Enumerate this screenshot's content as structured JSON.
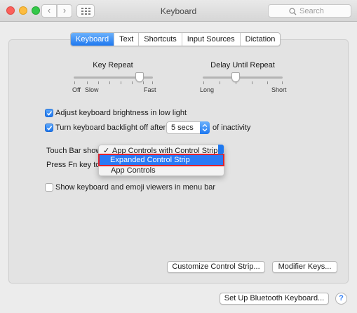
{
  "window": {
    "title": "Keyboard"
  },
  "toolbar": {
    "back": "‹",
    "forward": "›",
    "search_placeholder": "Search"
  },
  "tabs": [
    {
      "label": "Keyboard",
      "active": true
    },
    {
      "label": "Text",
      "active": false
    },
    {
      "label": "Shortcuts",
      "active": false
    },
    {
      "label": "Input Sources",
      "active": false
    },
    {
      "label": "Dictation",
      "active": false
    }
  ],
  "key_repeat": {
    "title": "Key Repeat",
    "min_label_1": "Off",
    "min_label_2": "Slow",
    "max_label": "Fast",
    "level": 0.88
  },
  "delay_until_repeat": {
    "title": "Delay Until Repeat",
    "min_label": "Long",
    "max_label": "Short",
    "level": 0.4
  },
  "options": {
    "adjust_brightness": {
      "label": "Adjust keyboard brightness in low light",
      "checked": true
    },
    "backlight_off": {
      "label": "Turn keyboard backlight off after",
      "checked": true,
      "value": "5 secs",
      "suffix": "of inactivity"
    },
    "touch_bar_label": "Touch Bar shows",
    "fn_label": "Press Fn key to",
    "viewers": {
      "label": "Show keyboard and emoji viewers in menu bar",
      "checked": false
    }
  },
  "touch_bar_menu": {
    "items": [
      {
        "label": "App Controls with Control Strip",
        "checked": true
      },
      {
        "label": "Expanded Control Strip",
        "selected": true
      },
      {
        "label": "App Controls"
      }
    ]
  },
  "buttons": {
    "customize": "Customize Control Strip...",
    "modifier": "Modifier Keys...",
    "bluetooth": "Set Up Bluetooth Keyboard...",
    "help": "?"
  },
  "colors": {
    "accent": "#1e78f0",
    "highlight_outline": "#e1222b"
  }
}
